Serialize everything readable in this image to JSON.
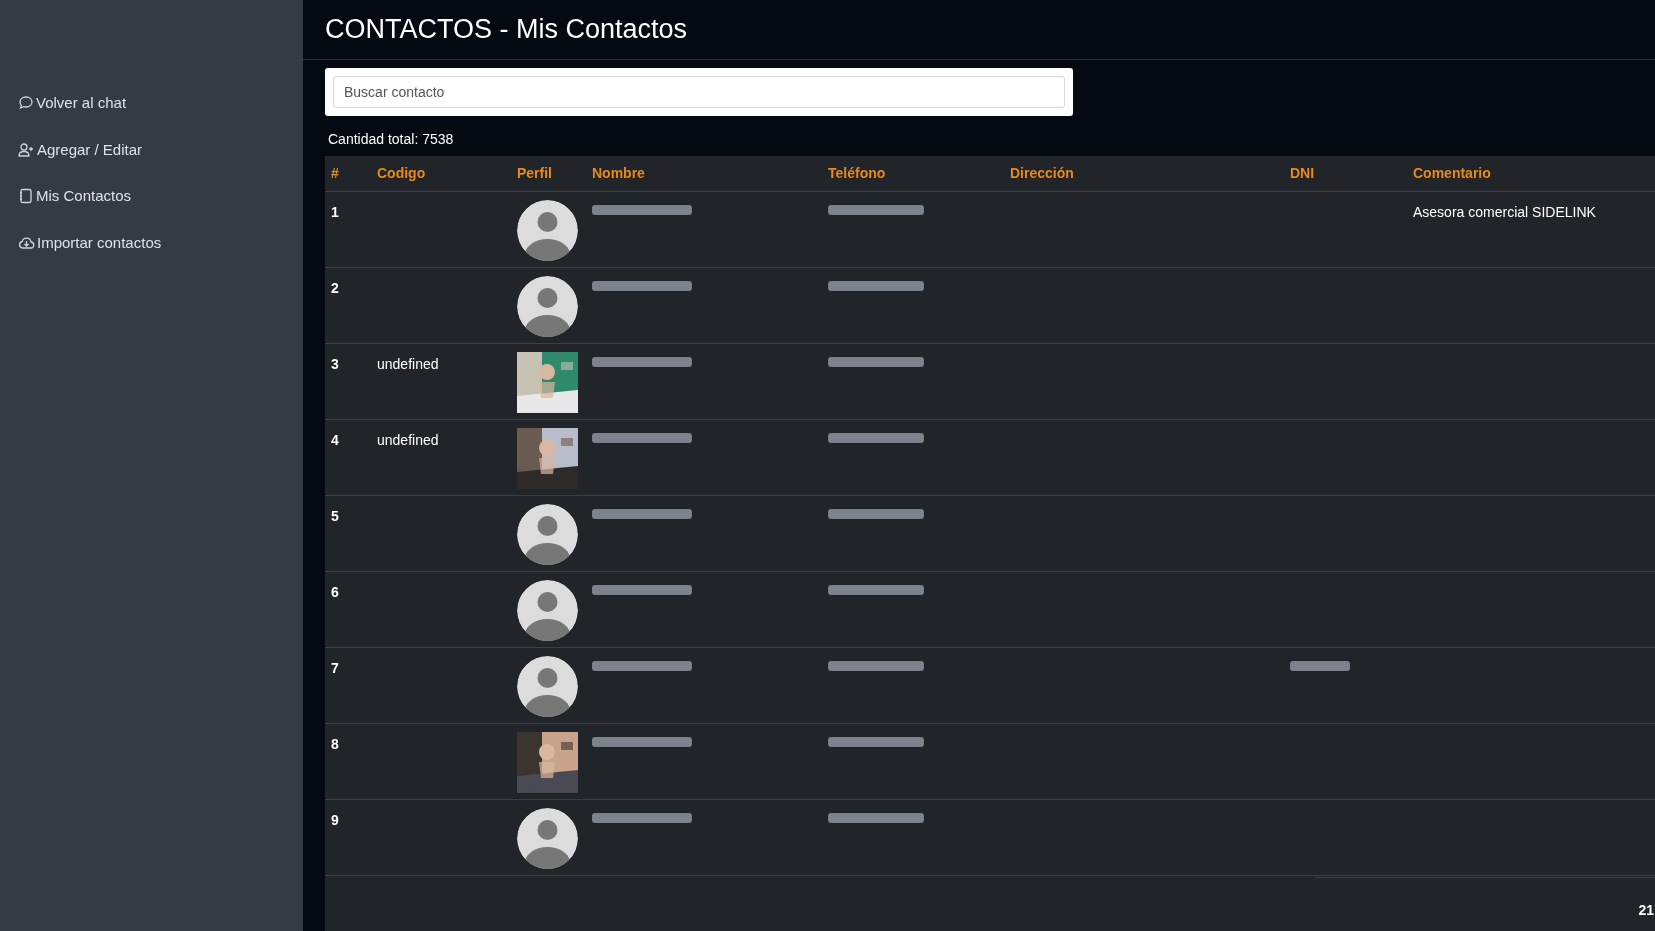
{
  "sidebar": {
    "items": [
      {
        "label": "Volver al chat"
      },
      {
        "label": "Agregar / Editar"
      },
      {
        "label": "Mis Contactos"
      },
      {
        "label": "Importar contactos"
      }
    ]
  },
  "title": "CONTACTOS - Mis Contactos",
  "search": {
    "placeholder": "Buscar contacto"
  },
  "total": "Cantidad total: 7538",
  "table": {
    "columns": [
      "#",
      "Codigo",
      "Perfil",
      "Nombre",
      "Teléfono",
      "Dirección",
      "DNI",
      "Comentario"
    ],
    "rows": [
      {
        "index": "1",
        "avatar": {
          "kind": "default"
        },
        "name": {
          "redacted": true
        },
        "phone": {
          "redacted": true
        },
        "comment": "Asesora comercial SIDELINK"
      },
      {
        "index": "2",
        "avatar": {
          "kind": "default"
        },
        "name": {
          "redacted": true
        },
        "phone": {
          "redacted": true
        }
      },
      {
        "index": "3",
        "code": "undefined",
        "name": {
          "redacted": true
        },
        "phone": {
          "redacted": true
        }
      },
      {
        "index": "4",
        "code": "undefined",
        "name": {
          "redacted": true
        },
        "phone": {
          "redacted": true
        }
      },
      {
        "index": "5",
        "avatar": {
          "kind": "default"
        },
        "name": {
          "redacted": true
        },
        "phone": {
          "redacted": true
        }
      },
      {
        "index": "6",
        "avatar": {
          "kind": "default"
        },
        "name": {
          "redacted": true
        },
        "phone": {
          "redacted": true
        }
      },
      {
        "index": "7",
        "avatar": {
          "kind": "default"
        },
        "name": {
          "redacted": true
        },
        "phone": {
          "redacted": true
        },
        "dni": {
          "redacted": true
        }
      },
      {
        "index": "8",
        "name": {
          "redacted": true
        },
        "phone": {
          "redacted": true
        }
      },
      {
        "index": "9",
        "avatar": {
          "kind": "default"
        },
        "name": {
          "redacted": true
        },
        "phone": {
          "redacted": true
        }
      }
    ]
  },
  "pager_fragment": "21"
}
